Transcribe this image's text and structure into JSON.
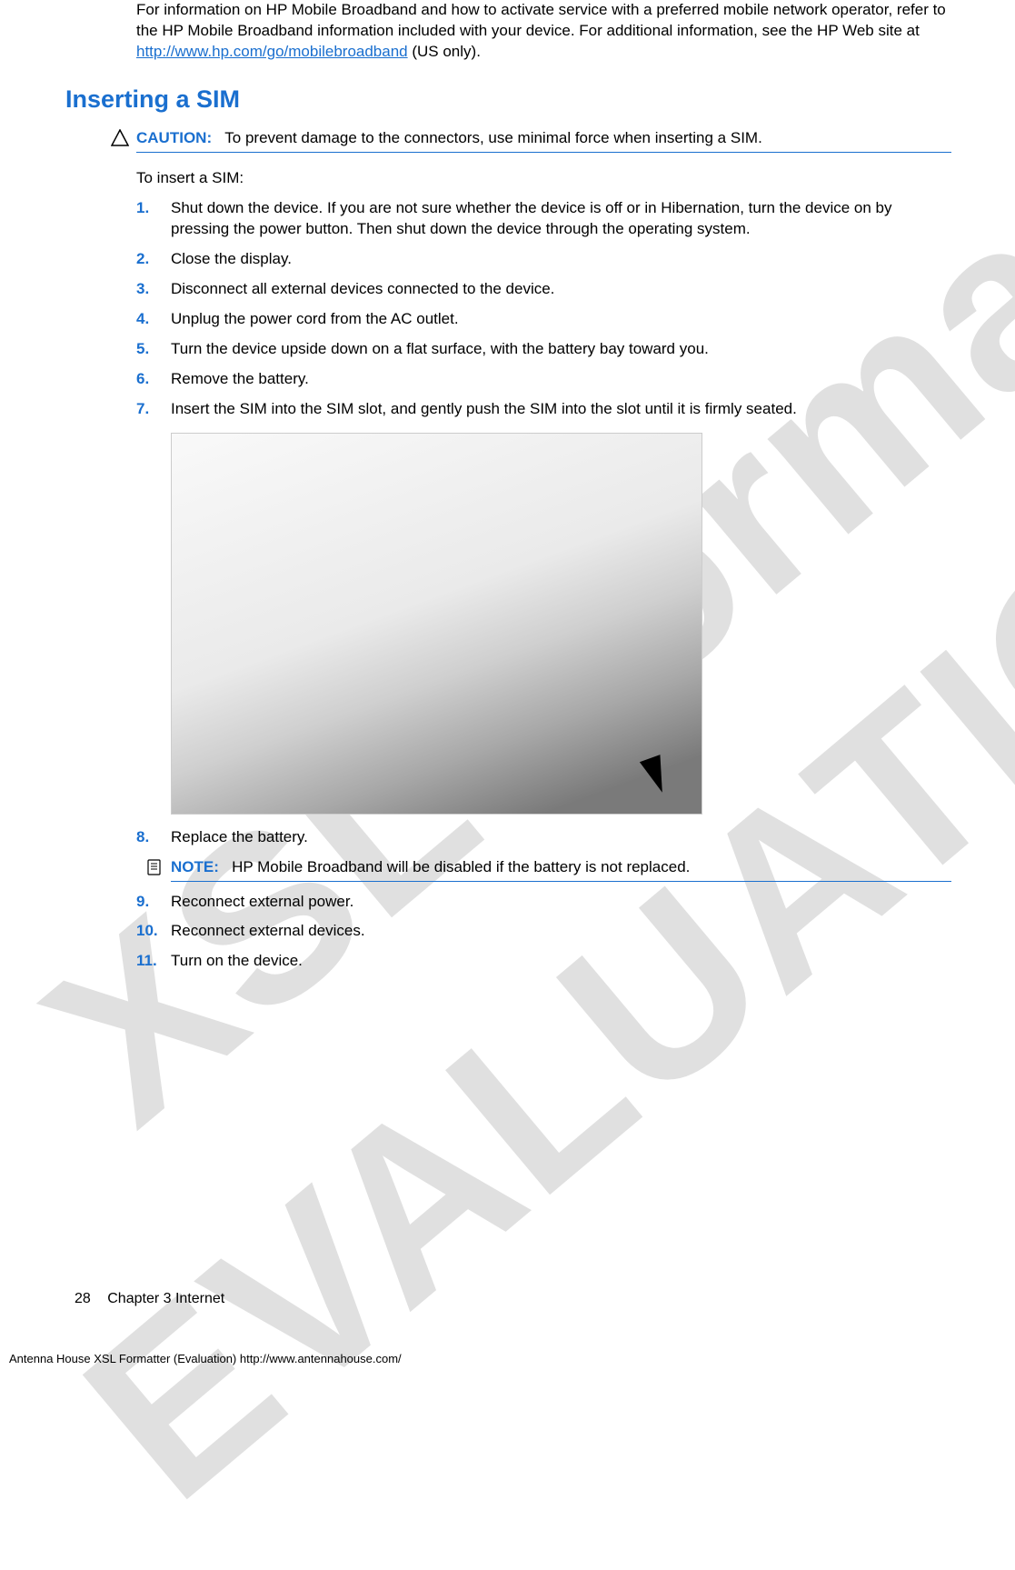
{
  "watermarks": {
    "line1": "XSL Formatter",
    "line2": "EVALUATION"
  },
  "intro": {
    "before_link": "For information on HP Mobile Broadband and how to activate service with a preferred mobile network operator, refer to the HP Mobile Broadband information included with your device. For additional information, see the HP Web site at ",
    "link_text": "http://www.hp.com/go/mobilebroadband",
    "after_link": " (US only)."
  },
  "section_title": "Inserting a SIM",
  "caution": {
    "label": "CAUTION:",
    "text": "To prevent damage to the connectors, use minimal force when inserting a SIM."
  },
  "lead_text": "To insert a SIM:",
  "steps_a": [
    {
      "n": "1.",
      "t": "Shut down the device. If you are not sure whether the device is off or in Hibernation, turn the device on by pressing the power button. Then shut down the device through the operating system."
    },
    {
      "n": "2.",
      "t": "Close the display."
    },
    {
      "n": "3.",
      "t": "Disconnect all external devices connected to the device."
    },
    {
      "n": "4.",
      "t": "Unplug the power cord from the AC outlet."
    },
    {
      "n": "5.",
      "t": "Turn the device upside down on a flat surface, with the battery bay toward you."
    },
    {
      "n": "6.",
      "t": "Remove the battery."
    },
    {
      "n": "7.",
      "t": "Insert the SIM into the SIM slot, and gently push the SIM into the slot until it is firmly seated."
    }
  ],
  "step8": {
    "n": "8.",
    "t": "Replace the battery."
  },
  "note": {
    "label": "NOTE:",
    "text": "HP Mobile Broadband will be disabled if the battery is not replaced."
  },
  "steps_b": [
    {
      "n": "9.",
      "t": "Reconnect external power."
    },
    {
      "n": "10.",
      "t": "Reconnect external devices."
    },
    {
      "n": "11.",
      "t": "Turn on the device."
    }
  ],
  "footer": {
    "page_num": "28",
    "chapter": "Chapter 3   Internet"
  },
  "formatter_line": "Antenna House XSL Formatter (Evaluation)  http://www.antennahouse.com/"
}
